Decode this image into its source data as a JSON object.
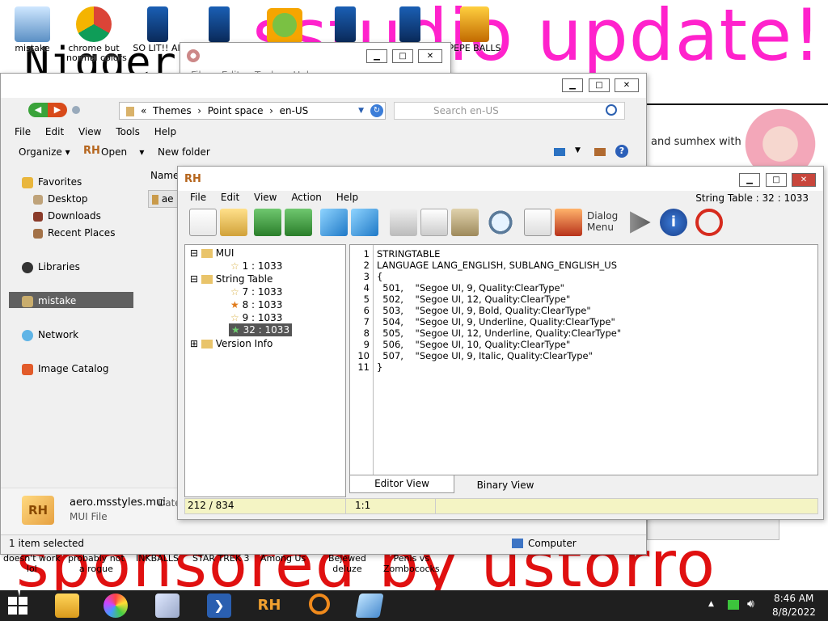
{
  "desktop": {
    "icons": [
      {
        "label": "mistake"
      },
      {
        "label": "chrome but\nnormal colors"
      },
      {
        "label": "SO LIT!! All"
      },
      {
        "label": "PEPE BALLS"
      }
    ],
    "bottom_icons": [
      {
        "label": "doesn't work\nlol"
      },
      {
        "label": "probably not\na rogue"
      },
      {
        "label": "INKBALLS"
      },
      {
        "label": "STAR TREK 3"
      },
      {
        "label": "Among Us"
      },
      {
        "label": "Bejewed\ndeluze"
      },
      {
        "label": "Penis vs\nZombococks"
      }
    ],
    "big_text_top": "sstudio update!",
    "big_text_left": "Nigger",
    "big_text_bottom": "sponsored by ustorro",
    "side_text": "and sumhex with",
    "colors": {
      "magenta": "#ff22cc",
      "red": "#e01010"
    }
  },
  "bgwindow": {
    "menu": [
      "File",
      "Edit",
      "Tools",
      "Help"
    ],
    "min": "▁",
    "max": "□",
    "close": "✕"
  },
  "explorer": {
    "address": {
      "prefix": "«",
      "crumbs": [
        "Themes",
        "Point space",
        "en-US"
      ]
    },
    "search_placeholder": "Search en-US",
    "menu": [
      "File",
      "Edit",
      "View",
      "Tools",
      "Help"
    ],
    "toolbar": {
      "organize": "Organize",
      "open": "Open",
      "new_folder": "New folder"
    },
    "nav": [
      {
        "label": "Favorites"
      },
      {
        "label": "Desktop"
      },
      {
        "label": "Downloads"
      },
      {
        "label": "Recent Places"
      },
      {
        "label": "Libraries"
      },
      {
        "label": "mistake"
      },
      {
        "label": "Network"
      },
      {
        "label": "Image Catalog"
      }
    ],
    "column_name": "Name",
    "file_short": "ae",
    "details": {
      "filename": "aero.msstyles.mui",
      "date_label": "Date",
      "type": "MUI File"
    },
    "status_left": "1 item selected",
    "status_right": "Computer"
  },
  "rh": {
    "title_icon": "RH",
    "menu": [
      "File",
      "Edit",
      "View",
      "Action",
      "Help"
    ],
    "status_title": "String Table : 32 : 1033",
    "dialog_btn": "Dialog\nMenu",
    "tree": [
      {
        "label": "MUI"
      },
      {
        "label": "1 : 1033"
      },
      {
        "label": "String Table"
      },
      {
        "label": "7 : 1033"
      },
      {
        "label": "8 : 1033"
      },
      {
        "label": "9 : 1033"
      },
      {
        "label": "32 : 1033"
      },
      {
        "label": "Version Info"
      }
    ],
    "code_lines": [
      "STRINGTABLE",
      "LANGUAGE LANG_ENGLISH, SUBLANG_ENGLISH_US",
      "{",
      "  501,    \"Segoe UI, 9, Quality:ClearType\"",
      "  502,    \"Segoe UI, 12, Quality:ClearType\"",
      "  503,    \"Segoe UI, 9, Bold, Quality:ClearType\"",
      "  504,    \"Segoe UI, 9, Underline, Quality:ClearType\"",
      "  505,    \"Segoe UI, 12, Underline, Quality:ClearType\"",
      "  506,    \"Segoe UI, 10, Quality:ClearType\"",
      "  507,    \"Segoe UI, 9, Italic, Quality:ClearType\"",
      "}"
    ],
    "line_numbers": [
      "1",
      "2",
      "3",
      "4",
      "5",
      "6",
      "7",
      "8",
      "9",
      "10",
      "11"
    ],
    "tabs": {
      "editor": "Editor View",
      "binary": "Binary View"
    },
    "status": {
      "count": "212 / 834",
      "pos": "1:1"
    }
  },
  "taskbar": {
    "rh_label": "RH",
    "time": "8:46 AM",
    "date": "8/8/2022"
  }
}
